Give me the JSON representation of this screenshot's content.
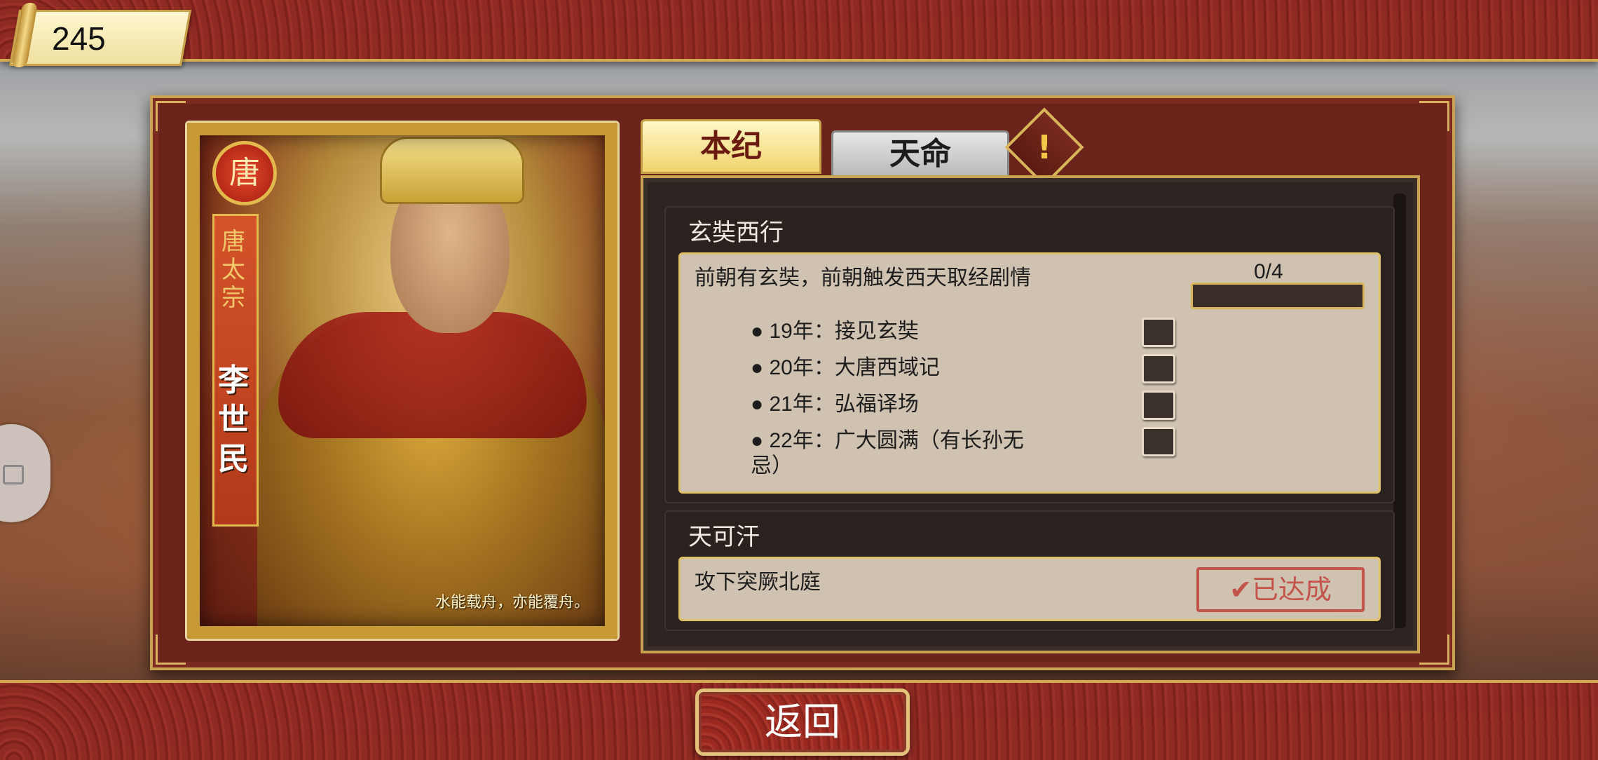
{
  "score": "245",
  "portrait": {
    "emblem": "唐",
    "title": "唐太宗",
    "name": "李世民",
    "quote": "水能载舟，亦能覆舟。"
  },
  "tabs": [
    {
      "label": "本纪",
      "active": true
    },
    {
      "label": "天命",
      "active": false
    }
  ],
  "info_icon": "!",
  "sections": [
    {
      "title": "玄奘西行",
      "description": "前朝有玄奘，前朝触发西天取经剧情",
      "progress_text": "0/4",
      "progress": 0,
      "tasks": [
        {
          "text": "● 19年：接见玄奘",
          "checked": false
        },
        {
          "text": "● 20年：大唐西域记",
          "checked": false
        },
        {
          "text": "● 21年：弘福译场",
          "checked": false
        },
        {
          "text": "● 22年：广大圆满（有长孙无忌）",
          "checked": false
        }
      ]
    },
    {
      "title": "天可汗",
      "description": "攻下突厥北庭",
      "stamp": "✔已达成"
    }
  ],
  "back_button": "返回",
  "colors": {
    "panel_red": "#6b2419",
    "gold_border": "#caa352",
    "active_tab": "#f0d36c",
    "stamp_red": "#c2413b"
  }
}
